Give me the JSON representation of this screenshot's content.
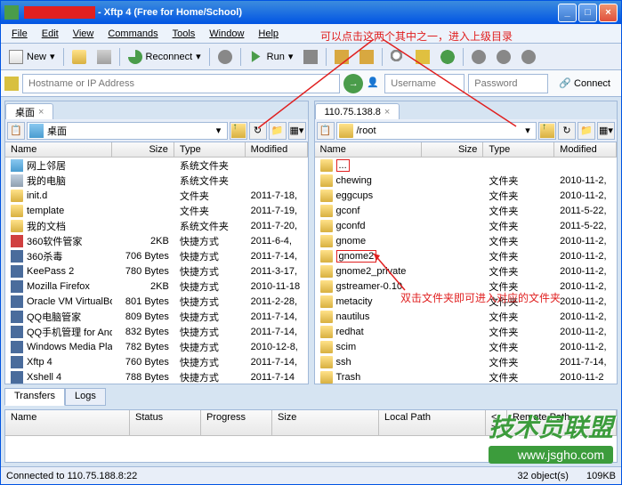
{
  "title_app": " - Xftp 4 (Free for Home/School)",
  "menu": [
    "File",
    "Edit",
    "View",
    "Commands",
    "Tools",
    "Window",
    "Help"
  ],
  "toolbar": {
    "new_label": "New",
    "reconnect_label": "Reconnect",
    "run_label": "Run"
  },
  "addr": {
    "host_ph": "Hostname or IP Address",
    "user_ph": "Username",
    "pass_ph": "Password",
    "connect": "Connect"
  },
  "annotations": {
    "top": "可以点击这两个其中之一，进入上级目录",
    "mid": "双击文件夹即可进入对应的文件夹"
  },
  "left": {
    "tab": "桌面",
    "combo": "桌面",
    "cols": [
      "Name",
      "Size",
      "Type",
      "Modified"
    ],
    "rows": [
      {
        "icon": "fi-sys",
        "name": "网上邻居",
        "size": "",
        "type": "系统文件夹",
        "mod": ""
      },
      {
        "icon": "fi-drive",
        "name": "我的电脑",
        "size": "",
        "type": "系统文件夹",
        "mod": ""
      },
      {
        "icon": "fi-folder",
        "name": "init.d",
        "size": "",
        "type": "文件夹",
        "mod": "2011-7-18,"
      },
      {
        "icon": "fi-folder",
        "name": "template",
        "size": "",
        "type": "文件夹",
        "mod": "2011-7-19,"
      },
      {
        "icon": "fi-folder",
        "name": "我的文档",
        "size": "",
        "type": "系统文件夹",
        "mod": "2011-7-20,"
      },
      {
        "icon": "fi-red",
        "name": "360软件管家",
        "size": "2KB",
        "type": "快捷方式",
        "mod": "2011-6-4,"
      },
      {
        "icon": "fi-app",
        "name": "360杀毒",
        "size": "706 Bytes",
        "type": "快捷方式",
        "mod": "2011-7-14,"
      },
      {
        "icon": "fi-app",
        "name": "KeePass 2",
        "size": "780 Bytes",
        "type": "快捷方式",
        "mod": "2011-3-17,"
      },
      {
        "icon": "fi-app",
        "name": "Mozilla Firefox",
        "size": "2KB",
        "type": "快捷方式",
        "mod": "2010-11-18"
      },
      {
        "icon": "fi-app",
        "name": "Oracle VM VirtualBox",
        "size": "801 Bytes",
        "type": "快捷方式",
        "mod": "2011-2-28,"
      },
      {
        "icon": "fi-app",
        "name": "QQ电脑管家",
        "size": "809 Bytes",
        "type": "快捷方式",
        "mod": "2011-7-14,"
      },
      {
        "icon": "fi-app",
        "name": "QQ手机管理 for And...",
        "size": "832 Bytes",
        "type": "快捷方式",
        "mod": "2011-7-14,"
      },
      {
        "icon": "fi-app",
        "name": "Windows Media Player",
        "size": "782 Bytes",
        "type": "快捷方式",
        "mod": "2010-12-8,"
      },
      {
        "icon": "fi-app",
        "name": "Xftp 4",
        "size": "760 Bytes",
        "type": "快捷方式",
        "mod": "2011-7-14,"
      },
      {
        "icon": "fi-app",
        "name": "Xshell 4",
        "size": "788 Bytes",
        "type": "快捷方式",
        "mod": "2011-7-14"
      }
    ]
  },
  "right": {
    "tab": "110.75.138.8",
    "combo": "/root",
    "cols": [
      "Name",
      "Size",
      "Type",
      "Modified"
    ],
    "rows": [
      {
        "icon": "fi-folder",
        "name": "...",
        "size": "",
        "type": "",
        "mod": "",
        "sel": true
      },
      {
        "icon": "fi-folder",
        "name": "chewing",
        "size": "",
        "type": "文件夹",
        "mod": "2010-11-2,"
      },
      {
        "icon": "fi-folder",
        "name": "eggcups",
        "size": "",
        "type": "文件夹",
        "mod": "2010-11-2,"
      },
      {
        "icon": "fi-folder",
        "name": "gconf",
        "size": "",
        "type": "文件夹",
        "mod": "2011-5-22,"
      },
      {
        "icon": "fi-folder",
        "name": "gconfd",
        "size": "",
        "type": "文件夹",
        "mod": "2011-5-22,"
      },
      {
        "icon": "fi-folder",
        "name": "gnome",
        "size": "",
        "type": "文件夹",
        "mod": "2010-11-2,"
      },
      {
        "icon": "fi-folder",
        "name": "gnome2",
        "size": "",
        "type": "文件夹",
        "mod": "2010-11-2,",
        "sel": true
      },
      {
        "icon": "fi-folder",
        "name": "gnome2_private",
        "size": "",
        "type": "文件夹",
        "mod": "2010-11-2,"
      },
      {
        "icon": "fi-folder",
        "name": "gstreamer-0.10",
        "size": "",
        "type": "文件夹",
        "mod": "2010-11-2,"
      },
      {
        "icon": "fi-folder",
        "name": "metacity",
        "size": "",
        "type": "文件夹",
        "mod": "2010-11-2,"
      },
      {
        "icon": "fi-folder",
        "name": "nautilus",
        "size": "",
        "type": "文件夹",
        "mod": "2010-11-2,"
      },
      {
        "icon": "fi-folder",
        "name": "redhat",
        "size": "",
        "type": "文件夹",
        "mod": "2010-11-2,"
      },
      {
        "icon": "fi-folder",
        "name": "scim",
        "size": "",
        "type": "文件夹",
        "mod": "2010-11-2,"
      },
      {
        "icon": "fi-folder",
        "name": "ssh",
        "size": "",
        "type": "文件夹",
        "mod": "2011-7-14,"
      },
      {
        "icon": "fi-folder",
        "name": "Trash",
        "size": "",
        "type": "文件夹",
        "mod": "2010-11-2"
      }
    ]
  },
  "transfers": {
    "tabs": [
      "Transfers",
      "Logs"
    ],
    "cols": [
      "Name",
      "Status",
      "Progress",
      "Size",
      "Local Path",
      "<->",
      "Remote Path"
    ]
  },
  "status": {
    "left": "Connected to 110.75.188.8:22",
    "mid": "32 object(s)",
    "right": "109KB"
  },
  "watermark": {
    "top": "技术员联盟",
    "bot": "www.jsgho.com"
  }
}
